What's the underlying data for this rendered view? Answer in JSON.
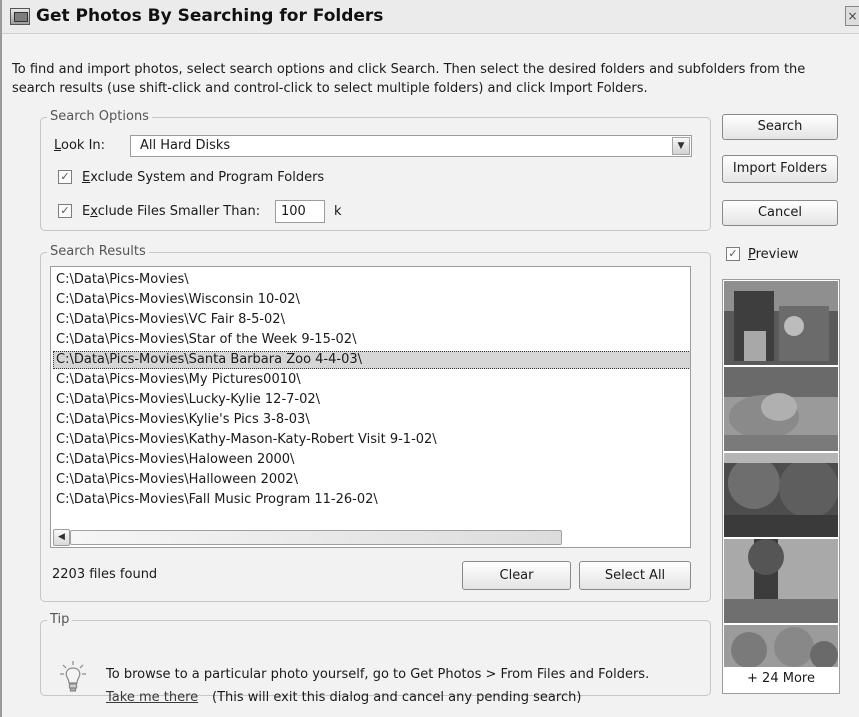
{
  "window": {
    "title": "Get Photos By Searching for Folders",
    "close_glyph": "×"
  },
  "description": "To find and import photos, select search options and click Search. Then select the desired folders and subfolders from the search results (use shift-click and control-click to select multiple folders) and click Import Folders.",
  "search_options": {
    "legend": "Search Options",
    "look_in_label_key": "L",
    "look_in_label_rest": "ook In:",
    "look_in_value": "All Hard Disks",
    "exclude_system_key": "E",
    "exclude_system_rest": "xclude System and Program Folders",
    "exclude_system_checked": true,
    "exclude_small_pre": "E",
    "exclude_small_key": "x",
    "exclude_small_rest": "clude Files Smaller Than:",
    "exclude_small_checked": true,
    "min_size_value": "100",
    "min_size_unit": "k"
  },
  "buttons": {
    "search": "Search",
    "import_folders": "Import Folders",
    "cancel": "Cancel",
    "clear": "Clear",
    "select_all": "Select All"
  },
  "preview": {
    "key": "P",
    "rest": "review",
    "checked": true,
    "more_label": "+ 24 More"
  },
  "search_results": {
    "legend": "Search Results",
    "files_found": "2203 files found",
    "selected_index": 4,
    "items": [
      "C:\\Data\\Pics-Movies\\",
      "C:\\Data\\Pics-Movies\\Wisconsin 10-02\\",
      "C:\\Data\\Pics-Movies\\VC Fair 8-5-02\\",
      "C:\\Data\\Pics-Movies\\Star of the Week 9-15-02\\",
      "C:\\Data\\Pics-Movies\\Santa Barbara Zoo 4-4-03\\",
      "C:\\Data\\Pics-Movies\\My Pictures0010\\",
      "C:\\Data\\Pics-Movies\\Lucky-Kylie 12-7-02\\",
      "C:\\Data\\Pics-Movies\\Kylie's Pics 3-8-03\\",
      "C:\\Data\\Pics-Movies\\Kathy-Mason-Katy-Robert Visit 9-1-02\\",
      "C:\\Data\\Pics-Movies\\Haloween 2000\\",
      "C:\\Data\\Pics-Movies\\Halloween 2002\\",
      "C:\\Data\\Pics-Movies\\Fall Music Program 11-26-02\\"
    ]
  },
  "tip": {
    "legend": "Tip",
    "text": "To browse to a particular photo yourself, go to Get Photos > From Files and Folders.",
    "link": "Take me there",
    "link_note": "(This will exit this dialog and cancel any pending search)"
  },
  "icons": {
    "checkmark": "✓",
    "dropdown": "▼",
    "scroll_up": "▲",
    "scroll_down": "▼",
    "scroll_left": "◀",
    "scroll_right": "▶"
  }
}
